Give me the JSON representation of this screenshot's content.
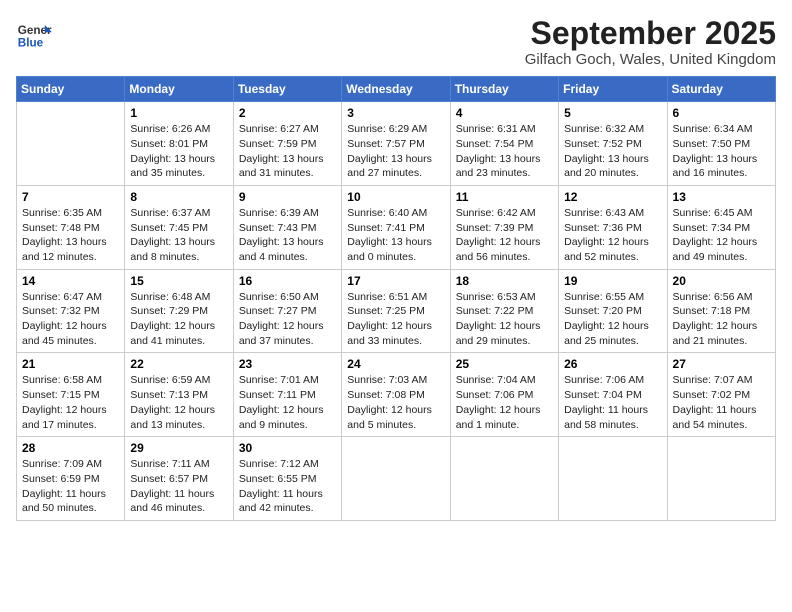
{
  "header": {
    "logo_line1": "General",
    "logo_line2": "Blue",
    "month": "September 2025",
    "location": "Gilfach Goch, Wales, United Kingdom"
  },
  "weekdays": [
    "Sunday",
    "Monday",
    "Tuesday",
    "Wednesday",
    "Thursday",
    "Friday",
    "Saturday"
  ],
  "weeks": [
    [
      {
        "day": "",
        "sunrise": "",
        "sunset": "",
        "daylight": ""
      },
      {
        "day": "1",
        "sunrise": "Sunrise: 6:26 AM",
        "sunset": "Sunset: 8:01 PM",
        "daylight": "Daylight: 13 hours and 35 minutes."
      },
      {
        "day": "2",
        "sunrise": "Sunrise: 6:27 AM",
        "sunset": "Sunset: 7:59 PM",
        "daylight": "Daylight: 13 hours and 31 minutes."
      },
      {
        "day": "3",
        "sunrise": "Sunrise: 6:29 AM",
        "sunset": "Sunset: 7:57 PM",
        "daylight": "Daylight: 13 hours and 27 minutes."
      },
      {
        "day": "4",
        "sunrise": "Sunrise: 6:31 AM",
        "sunset": "Sunset: 7:54 PM",
        "daylight": "Daylight: 13 hours and 23 minutes."
      },
      {
        "day": "5",
        "sunrise": "Sunrise: 6:32 AM",
        "sunset": "Sunset: 7:52 PM",
        "daylight": "Daylight: 13 hours and 20 minutes."
      },
      {
        "day": "6",
        "sunrise": "Sunrise: 6:34 AM",
        "sunset": "Sunset: 7:50 PM",
        "daylight": "Daylight: 13 hours and 16 minutes."
      }
    ],
    [
      {
        "day": "7",
        "sunrise": "Sunrise: 6:35 AM",
        "sunset": "Sunset: 7:48 PM",
        "daylight": "Daylight: 13 hours and 12 minutes."
      },
      {
        "day": "8",
        "sunrise": "Sunrise: 6:37 AM",
        "sunset": "Sunset: 7:45 PM",
        "daylight": "Daylight: 13 hours and 8 minutes."
      },
      {
        "day": "9",
        "sunrise": "Sunrise: 6:39 AM",
        "sunset": "Sunset: 7:43 PM",
        "daylight": "Daylight: 13 hours and 4 minutes."
      },
      {
        "day": "10",
        "sunrise": "Sunrise: 6:40 AM",
        "sunset": "Sunset: 7:41 PM",
        "daylight": "Daylight: 13 hours and 0 minutes."
      },
      {
        "day": "11",
        "sunrise": "Sunrise: 6:42 AM",
        "sunset": "Sunset: 7:39 PM",
        "daylight": "Daylight: 12 hours and 56 minutes."
      },
      {
        "day": "12",
        "sunrise": "Sunrise: 6:43 AM",
        "sunset": "Sunset: 7:36 PM",
        "daylight": "Daylight: 12 hours and 52 minutes."
      },
      {
        "day": "13",
        "sunrise": "Sunrise: 6:45 AM",
        "sunset": "Sunset: 7:34 PM",
        "daylight": "Daylight: 12 hours and 49 minutes."
      }
    ],
    [
      {
        "day": "14",
        "sunrise": "Sunrise: 6:47 AM",
        "sunset": "Sunset: 7:32 PM",
        "daylight": "Daylight: 12 hours and 45 minutes."
      },
      {
        "day": "15",
        "sunrise": "Sunrise: 6:48 AM",
        "sunset": "Sunset: 7:29 PM",
        "daylight": "Daylight: 12 hours and 41 minutes."
      },
      {
        "day": "16",
        "sunrise": "Sunrise: 6:50 AM",
        "sunset": "Sunset: 7:27 PM",
        "daylight": "Daylight: 12 hours and 37 minutes."
      },
      {
        "day": "17",
        "sunrise": "Sunrise: 6:51 AM",
        "sunset": "Sunset: 7:25 PM",
        "daylight": "Daylight: 12 hours and 33 minutes."
      },
      {
        "day": "18",
        "sunrise": "Sunrise: 6:53 AM",
        "sunset": "Sunset: 7:22 PM",
        "daylight": "Daylight: 12 hours and 29 minutes."
      },
      {
        "day": "19",
        "sunrise": "Sunrise: 6:55 AM",
        "sunset": "Sunset: 7:20 PM",
        "daylight": "Daylight: 12 hours and 25 minutes."
      },
      {
        "day": "20",
        "sunrise": "Sunrise: 6:56 AM",
        "sunset": "Sunset: 7:18 PM",
        "daylight": "Daylight: 12 hours and 21 minutes."
      }
    ],
    [
      {
        "day": "21",
        "sunrise": "Sunrise: 6:58 AM",
        "sunset": "Sunset: 7:15 PM",
        "daylight": "Daylight: 12 hours and 17 minutes."
      },
      {
        "day": "22",
        "sunrise": "Sunrise: 6:59 AM",
        "sunset": "Sunset: 7:13 PM",
        "daylight": "Daylight: 12 hours and 13 minutes."
      },
      {
        "day": "23",
        "sunrise": "Sunrise: 7:01 AM",
        "sunset": "Sunset: 7:11 PM",
        "daylight": "Daylight: 12 hours and 9 minutes."
      },
      {
        "day": "24",
        "sunrise": "Sunrise: 7:03 AM",
        "sunset": "Sunset: 7:08 PM",
        "daylight": "Daylight: 12 hours and 5 minutes."
      },
      {
        "day": "25",
        "sunrise": "Sunrise: 7:04 AM",
        "sunset": "Sunset: 7:06 PM",
        "daylight": "Daylight: 12 hours and 1 minute."
      },
      {
        "day": "26",
        "sunrise": "Sunrise: 7:06 AM",
        "sunset": "Sunset: 7:04 PM",
        "daylight": "Daylight: 11 hours and 58 minutes."
      },
      {
        "day": "27",
        "sunrise": "Sunrise: 7:07 AM",
        "sunset": "Sunset: 7:02 PM",
        "daylight": "Daylight: 11 hours and 54 minutes."
      }
    ],
    [
      {
        "day": "28",
        "sunrise": "Sunrise: 7:09 AM",
        "sunset": "Sunset: 6:59 PM",
        "daylight": "Daylight: 11 hours and 50 minutes."
      },
      {
        "day": "29",
        "sunrise": "Sunrise: 7:11 AM",
        "sunset": "Sunset: 6:57 PM",
        "daylight": "Daylight: 11 hours and 46 minutes."
      },
      {
        "day": "30",
        "sunrise": "Sunrise: 7:12 AM",
        "sunset": "Sunset: 6:55 PM",
        "daylight": "Daylight: 11 hours and 42 minutes."
      },
      {
        "day": "",
        "sunrise": "",
        "sunset": "",
        "daylight": ""
      },
      {
        "day": "",
        "sunrise": "",
        "sunset": "",
        "daylight": ""
      },
      {
        "day": "",
        "sunrise": "",
        "sunset": "",
        "daylight": ""
      },
      {
        "day": "",
        "sunrise": "",
        "sunset": "",
        "daylight": ""
      }
    ]
  ]
}
